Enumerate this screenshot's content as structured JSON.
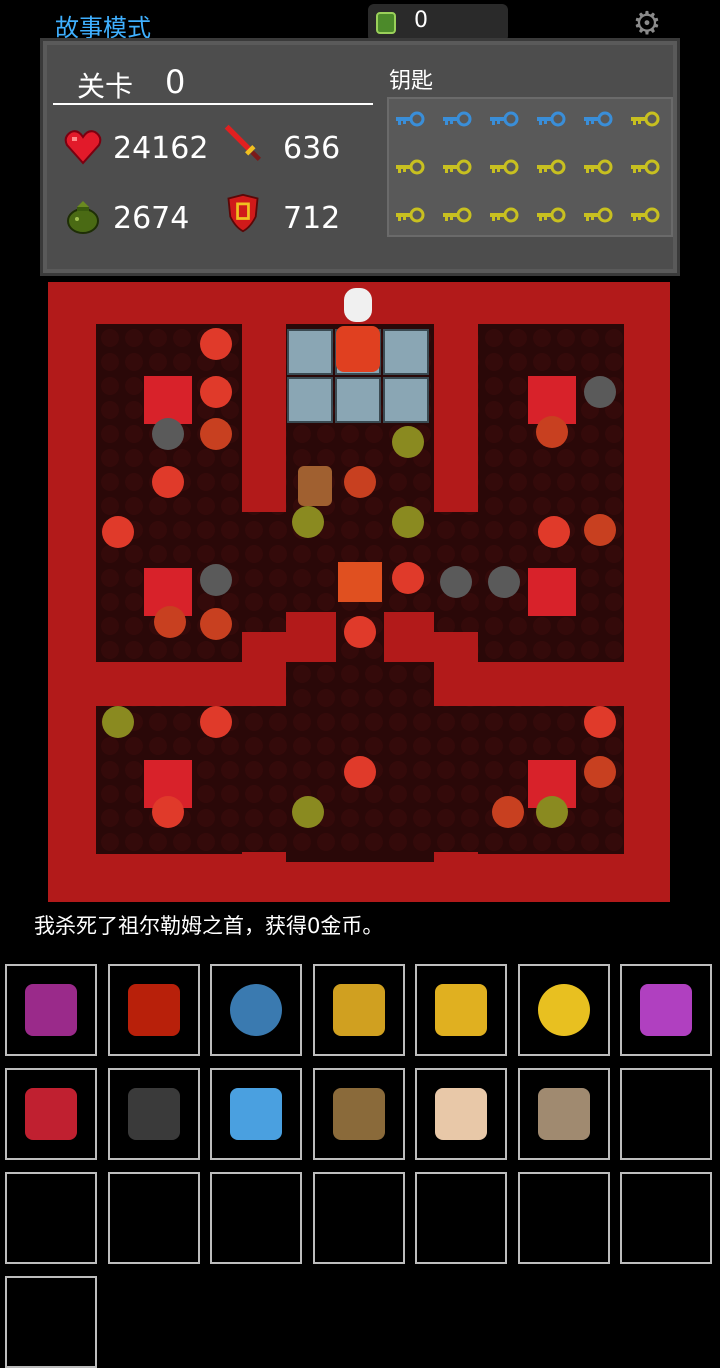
{
  "header": {
    "mode_title": "故事模式",
    "coin_count": "0",
    "settings_icon": "gear-icon"
  },
  "status": {
    "level_label": "关卡",
    "level_value": "0",
    "hp": "24162",
    "attack": "636",
    "gold": "2674",
    "defense": "712",
    "keys_label": "钥匙",
    "keys": {
      "blue": 5,
      "yellow": 13
    },
    "colors": {
      "blue_key": "#3a8ed8",
      "yellow_key": "#c8c020",
      "panel": "#4d4d4d"
    }
  },
  "map": {
    "wall_color": "#b21a1a",
    "floor_color": "#2a0808"
  },
  "message": "我杀死了祖尔勒姆之首，获得0金币。",
  "inventory": {
    "items": [
      "spellbook-icon",
      "red-staff-icon",
      "crystal-ball-icon",
      "blue-staff-icon",
      "holy-cross-icon",
      "gold-coin-icon",
      "amethyst-ring-icon",
      "amulet-icon",
      "dark-hood-icon",
      "blue-gauntlet-icon",
      "pickaxe-icon",
      "magic-scroll-icon",
      "skull-scroll-icon",
      "",
      "",
      "",
      "",
      "",
      "",
      "",
      "",
      ""
    ]
  }
}
